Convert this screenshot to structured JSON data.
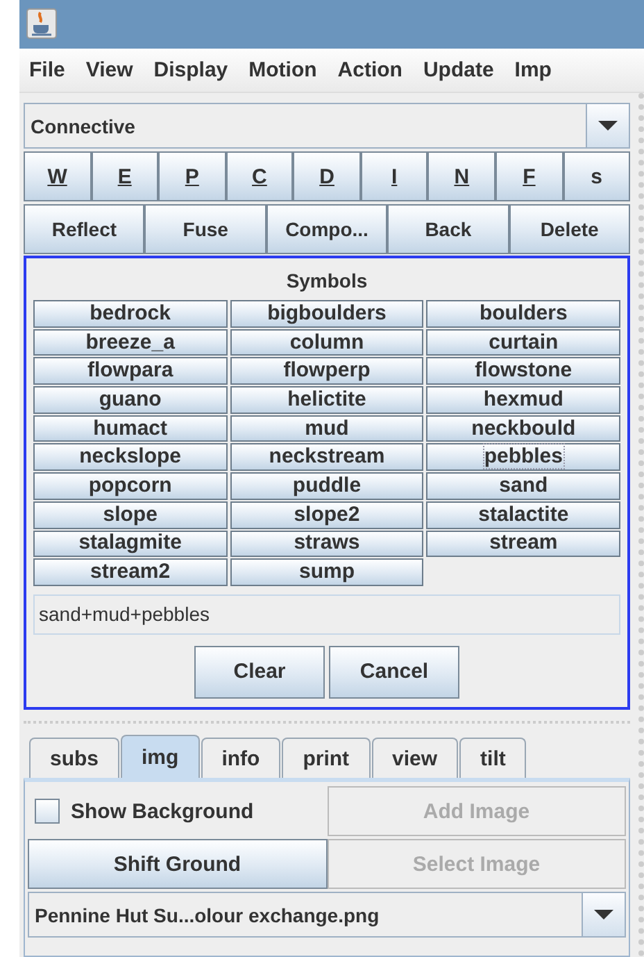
{
  "menu": [
    "File",
    "View",
    "Display",
    "Motion",
    "Action",
    "Update",
    "Imp"
  ],
  "type_combo": {
    "value": "Connective"
  },
  "letter_buttons": [
    {
      "label": "W",
      "mnemonic": true
    },
    {
      "label": "E",
      "mnemonic": true
    },
    {
      "label": "P",
      "mnemonic": true
    },
    {
      "label": "C",
      "mnemonic": true
    },
    {
      "label": "D",
      "mnemonic": true
    },
    {
      "label": "I",
      "mnemonic": true
    },
    {
      "label": "N",
      "mnemonic": true
    },
    {
      "label": "F",
      "mnemonic": true
    },
    {
      "label": "s",
      "mnemonic": false
    }
  ],
  "action_buttons": [
    "Reflect",
    "Fuse",
    "Compo...",
    "Back",
    "Delete"
  ],
  "symbols": {
    "title": "Symbols",
    "items": [
      {
        "label": "bedrock",
        "focused": false
      },
      {
        "label": "bigboulders",
        "focused": false
      },
      {
        "label": "boulders",
        "focused": false
      },
      {
        "label": "breeze_a",
        "focused": false
      },
      {
        "label": "column",
        "focused": false
      },
      {
        "label": "curtain",
        "focused": false
      },
      {
        "label": "flowpara",
        "focused": false
      },
      {
        "label": "flowperp",
        "focused": false
      },
      {
        "label": "flowstone",
        "focused": false
      },
      {
        "label": "guano",
        "focused": false
      },
      {
        "label": "helictite",
        "focused": false
      },
      {
        "label": "hexmud",
        "focused": false
      },
      {
        "label": "humact",
        "focused": false
      },
      {
        "label": "mud",
        "focused": false
      },
      {
        "label": "neckbould",
        "focused": false
      },
      {
        "label": "neckslope",
        "focused": false
      },
      {
        "label": "neckstream",
        "focused": false
      },
      {
        "label": "pebbles",
        "focused": true
      },
      {
        "label": "popcorn",
        "focused": false
      },
      {
        "label": "puddle",
        "focused": false
      },
      {
        "label": "sand",
        "focused": false
      },
      {
        "label": "slope",
        "focused": false
      },
      {
        "label": "slope2",
        "focused": false
      },
      {
        "label": "stalactite",
        "focused": false
      },
      {
        "label": "stalagmite",
        "focused": false
      },
      {
        "label": "straws",
        "focused": false
      },
      {
        "label": "stream",
        "focused": false
      },
      {
        "label": "stream2",
        "focused": false
      },
      {
        "label": "sump",
        "focused": false
      }
    ],
    "text": "sand+mud+pebbles",
    "buttons": [
      "Clear",
      "Cancel"
    ]
  },
  "tabs": [
    {
      "label": "subs",
      "selected": false
    },
    {
      "label": "img",
      "selected": true
    },
    {
      "label": "info",
      "selected": false
    },
    {
      "label": "print",
      "selected": false
    },
    {
      "label": "view",
      "selected": false
    },
    {
      "label": "tilt",
      "selected": false
    }
  ],
  "img_panel": {
    "cells": [
      {
        "kind": "checkbox",
        "label": "Show Background",
        "checked": false
      },
      {
        "kind": "button",
        "label": "Add Image",
        "disabled": true
      },
      {
        "kind": "button",
        "label": "Shift Ground",
        "disabled": false
      },
      {
        "kind": "button",
        "label": "Select Image",
        "disabled": true
      }
    ],
    "image_combo": {
      "value": "Pennine Hut Su...olour exchange.png"
    }
  }
}
